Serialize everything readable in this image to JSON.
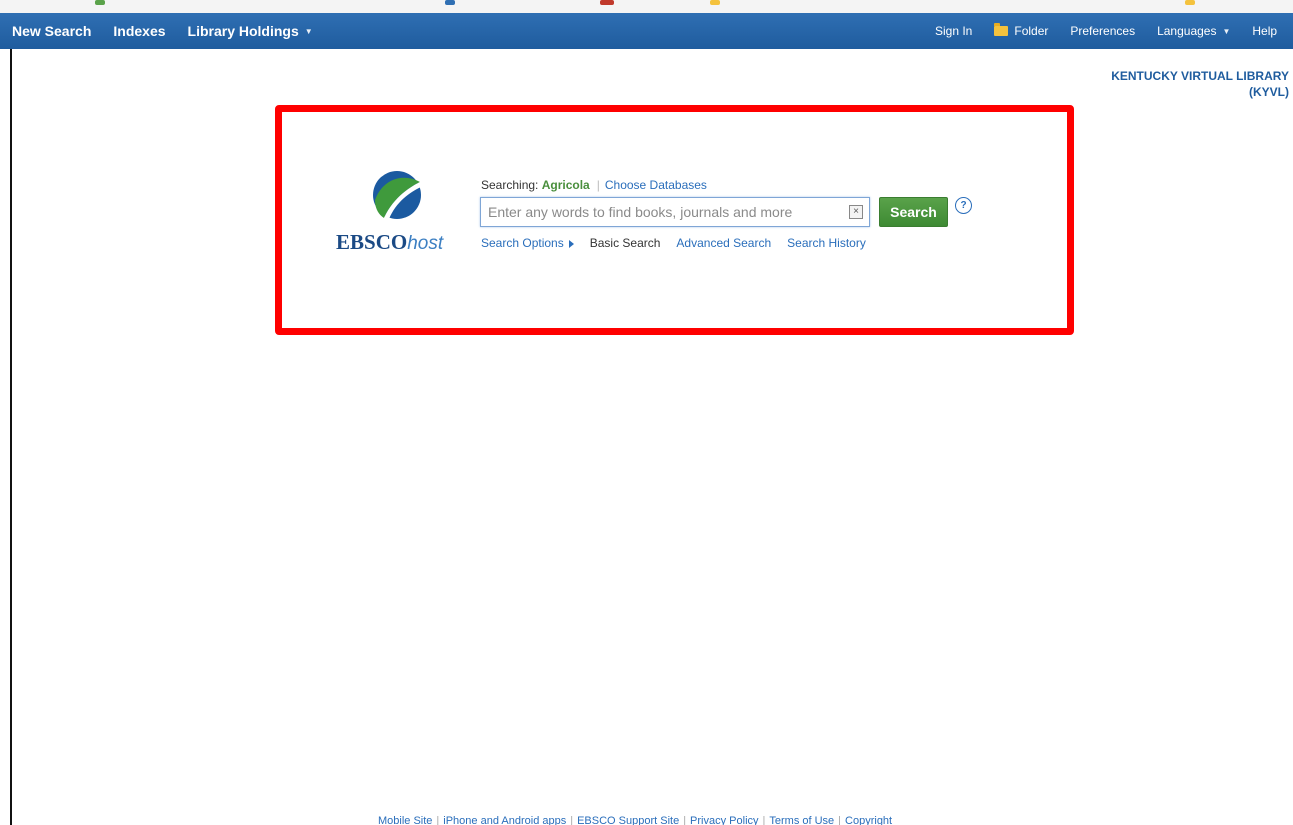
{
  "nav": {
    "left": [
      {
        "label": "New Search"
      },
      {
        "label": "Indexes"
      },
      {
        "label": "Library Holdings"
      }
    ],
    "right": {
      "sign_in": "Sign In",
      "folder": "Folder",
      "preferences": "Preferences",
      "languages": "Languages",
      "help": "Help"
    },
    "bar_color": "#1f5c9e"
  },
  "institution": {
    "line1": "KENTUCKY VIRTUAL LIBRARY",
    "line2": "(KYVL)"
  },
  "logo": {
    "brand": "EBSCO",
    "suffix": "host"
  },
  "search": {
    "searching_label": "Searching:",
    "database": "Agricola",
    "choose_databases": "Choose Databases",
    "placeholder": "Enter any words to find books, journals and more",
    "value": "",
    "button_label": "Search",
    "help_glyph": "?",
    "clear_glyph": "×",
    "options": {
      "search_options": "Search Options",
      "basic_search": "Basic Search",
      "advanced_search": "Advanced Search",
      "search_history": "Search History"
    }
  },
  "highlight": {
    "color": "#ff0000"
  },
  "footer": {
    "links": [
      "Mobile Site",
      "iPhone and Android apps",
      "EBSCO Support Site",
      "Privacy Policy",
      "Terms of Use",
      "Copyright"
    ]
  },
  "icons": {
    "folder": "folder-icon",
    "caret": "caret-down-icon",
    "clear": "clear-icon",
    "help": "help-icon",
    "arrow": "triangle-right-icon"
  }
}
